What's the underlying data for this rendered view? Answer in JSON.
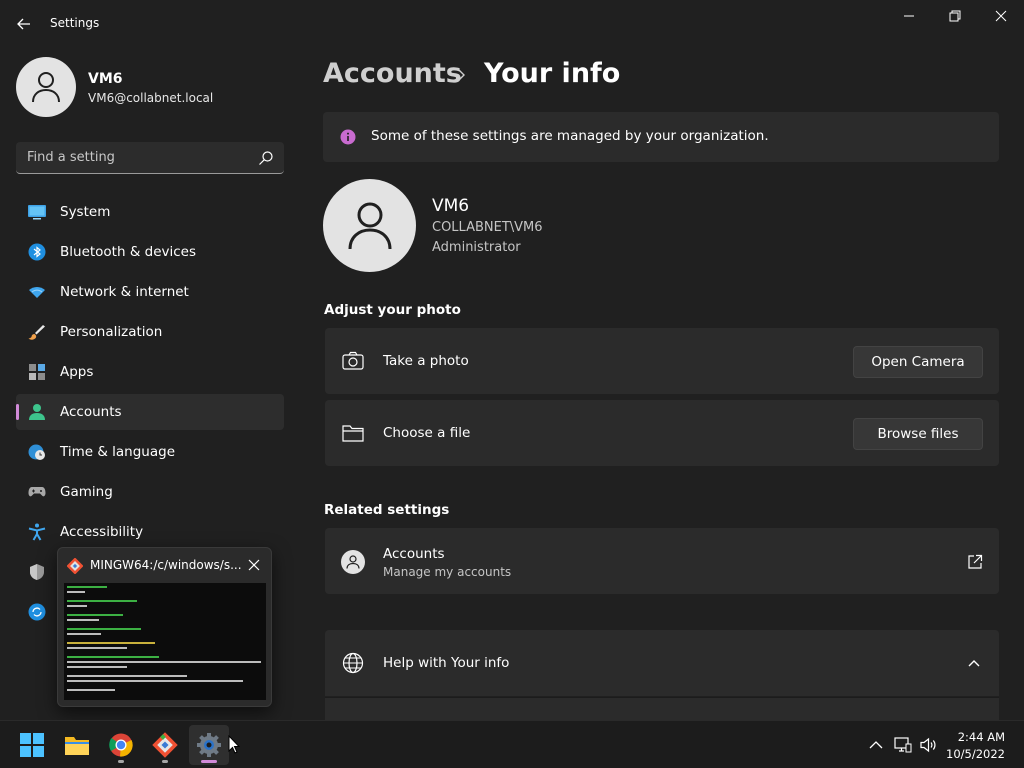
{
  "app": {
    "title": "Settings"
  },
  "colors": {
    "background": "#202020",
    "card": "#2b2b2b",
    "accent": "#d18ad8",
    "info": "#c96bd0"
  },
  "profile": {
    "name": "VM6",
    "email": "VM6@collabnet.local"
  },
  "search": {
    "placeholder": "Find a setting"
  },
  "sidebar": {
    "items": [
      {
        "label": "System",
        "icon": "monitor-icon"
      },
      {
        "label": "Bluetooth & devices",
        "icon": "bluetooth-icon"
      },
      {
        "label": "Network & internet",
        "icon": "wifi-icon"
      },
      {
        "label": "Personalization",
        "icon": "brush-icon"
      },
      {
        "label": "Apps",
        "icon": "apps-icon"
      },
      {
        "label": "Accounts",
        "icon": "person-icon",
        "active": true
      },
      {
        "label": "Time & language",
        "icon": "globe-clock-icon"
      },
      {
        "label": "Gaming",
        "icon": "gamepad-icon"
      },
      {
        "label": "Accessibility",
        "icon": "accessibility-icon"
      }
    ]
  },
  "breadcrumb": {
    "parent": "Accounts",
    "current": "Your info"
  },
  "banner": {
    "text": "Some of these settings are managed by your organization."
  },
  "user": {
    "name": "VM6",
    "domain": "COLLABNET\\VM6",
    "role": "Administrator"
  },
  "photo_section": {
    "title": "Adjust your photo",
    "rows": [
      {
        "label": "Take a photo",
        "button": "Open Camera",
        "icon": "camera-icon"
      },
      {
        "label": "Choose a file",
        "button": "Browse files",
        "icon": "folder-icon"
      }
    ]
  },
  "related": {
    "title": "Related settings",
    "accounts": {
      "title": "Accounts",
      "subtitle": "Manage my accounts"
    }
  },
  "help": {
    "title": "Help with Your info"
  },
  "preview": {
    "title": "MINGW64:/c/windows/s..."
  },
  "taskbar": {
    "apps": [
      "windows-start-icon",
      "file-explorer-icon",
      "chrome-icon",
      "git-bash-icon",
      "settings-gear-icon"
    ],
    "clock_time": "2:44 AM",
    "clock_date": "10/5/2022"
  }
}
